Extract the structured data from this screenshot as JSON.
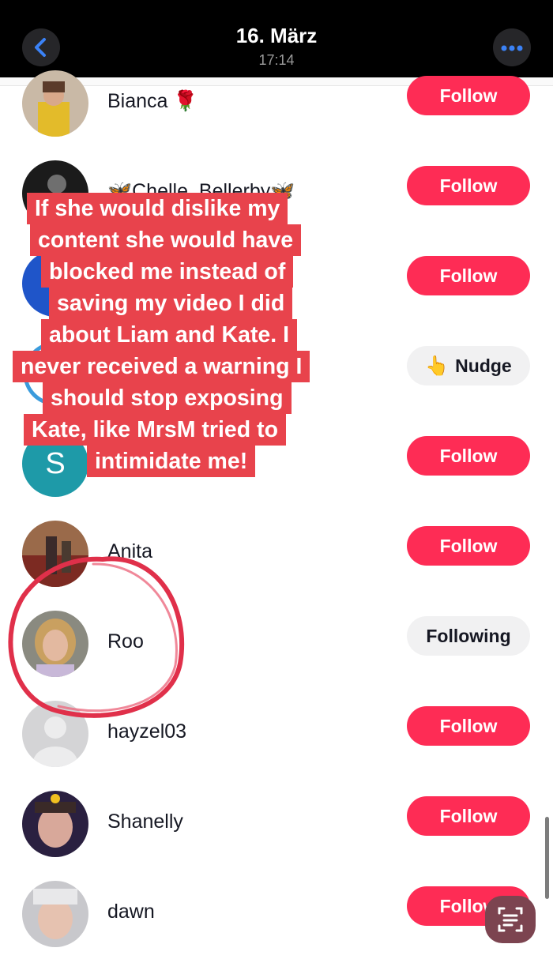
{
  "header": {
    "title": "16. März",
    "subtitle": "17:14"
  },
  "rows": [
    {
      "name": "Bianca 🌹",
      "button": "Follow"
    },
    {
      "name": "🦋Chelle_Bellerby🦋",
      "button": "Follow"
    },
    {
      "name": "",
      "button": "Follow"
    },
    {
      "name": "",
      "button": "Nudge"
    },
    {
      "name": "",
      "avatar_letter": "S",
      "button": "Follow"
    },
    {
      "name": "Anita",
      "button": "Follow"
    },
    {
      "name": "Roo",
      "button": "Following"
    },
    {
      "name": "hayzel03",
      "button": "Follow"
    },
    {
      "name": "Shanelly",
      "button": "Follow"
    },
    {
      "name": "dawn",
      "button": "Follow"
    }
  ],
  "caption": {
    "lines": [
      "If she would dislike my",
      "content she would have",
      "blocked me instead of",
      "saving my video I did",
      "about Liam and Kate. I",
      "never received a warning I",
      "should stop exposing",
      "Kate, like MrsM tried to",
      "intimidate me!"
    ]
  },
  "icons": {
    "back": "chevron-left-icon",
    "more": "more-horizontal-icon",
    "nudge": "pointing-hand-icon",
    "scan": "scan-text-icon"
  },
  "colors": {
    "follow": "#fe2c55",
    "caption_bg": "#e8434c",
    "accent_blue": "#3b82f6",
    "circle_red": "#e0304a"
  }
}
